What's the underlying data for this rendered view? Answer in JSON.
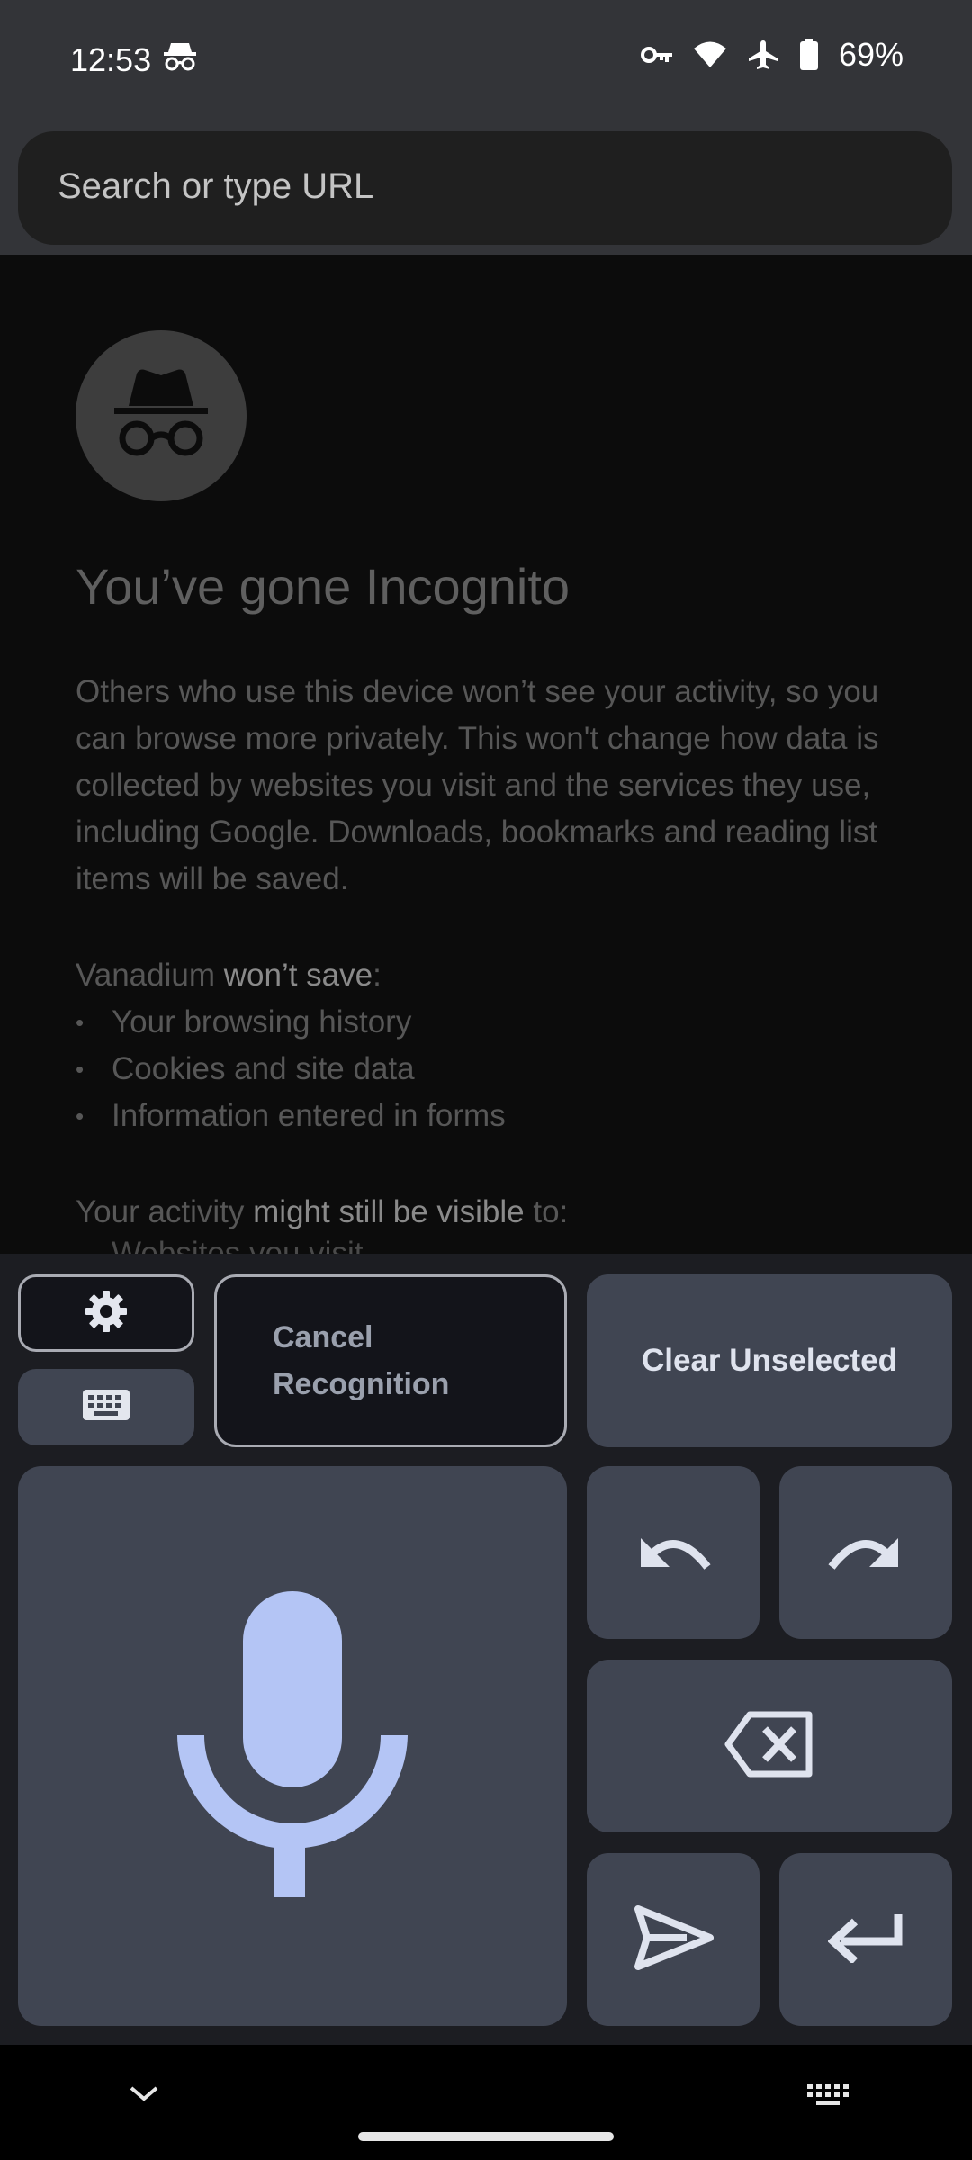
{
  "status": {
    "time": "12:53",
    "battery": "69%",
    "icons": [
      "incognito-icon",
      "vpn-key-icon",
      "wifi-icon",
      "airplane-mode-icon",
      "battery-icon"
    ]
  },
  "urlbar": {
    "placeholder": "Search or type URL"
  },
  "incognito": {
    "title": "You’ve gone Incognito",
    "body": "Others who use this device won’t see your activity, so you can browse more privately. This won't change how data is collected by websites you visit and the services they use, including Google. Downloads, bookmarks and reading list items will be saved.",
    "wont_save_prefix": "Vanadium ",
    "wont_save_bold": "won’t save",
    "wont_save_suffix": ":",
    "bullets": [
      "Your browsing history",
      "Cookies and site data",
      "Information entered in forms"
    ],
    "visible_prefix": "Your activity ",
    "visible_bold": "might still be visible",
    "visible_suffix": " to:",
    "peek": "Websites you visit"
  },
  "keyboard": {
    "cancel_line1": "Cancel",
    "cancel_line2": "Recognition",
    "clear_label": "Clear Unselected"
  },
  "colors": {
    "accent": "#b4c5f5",
    "button": "#404552",
    "keyboard_bg": "#1c1d22"
  }
}
